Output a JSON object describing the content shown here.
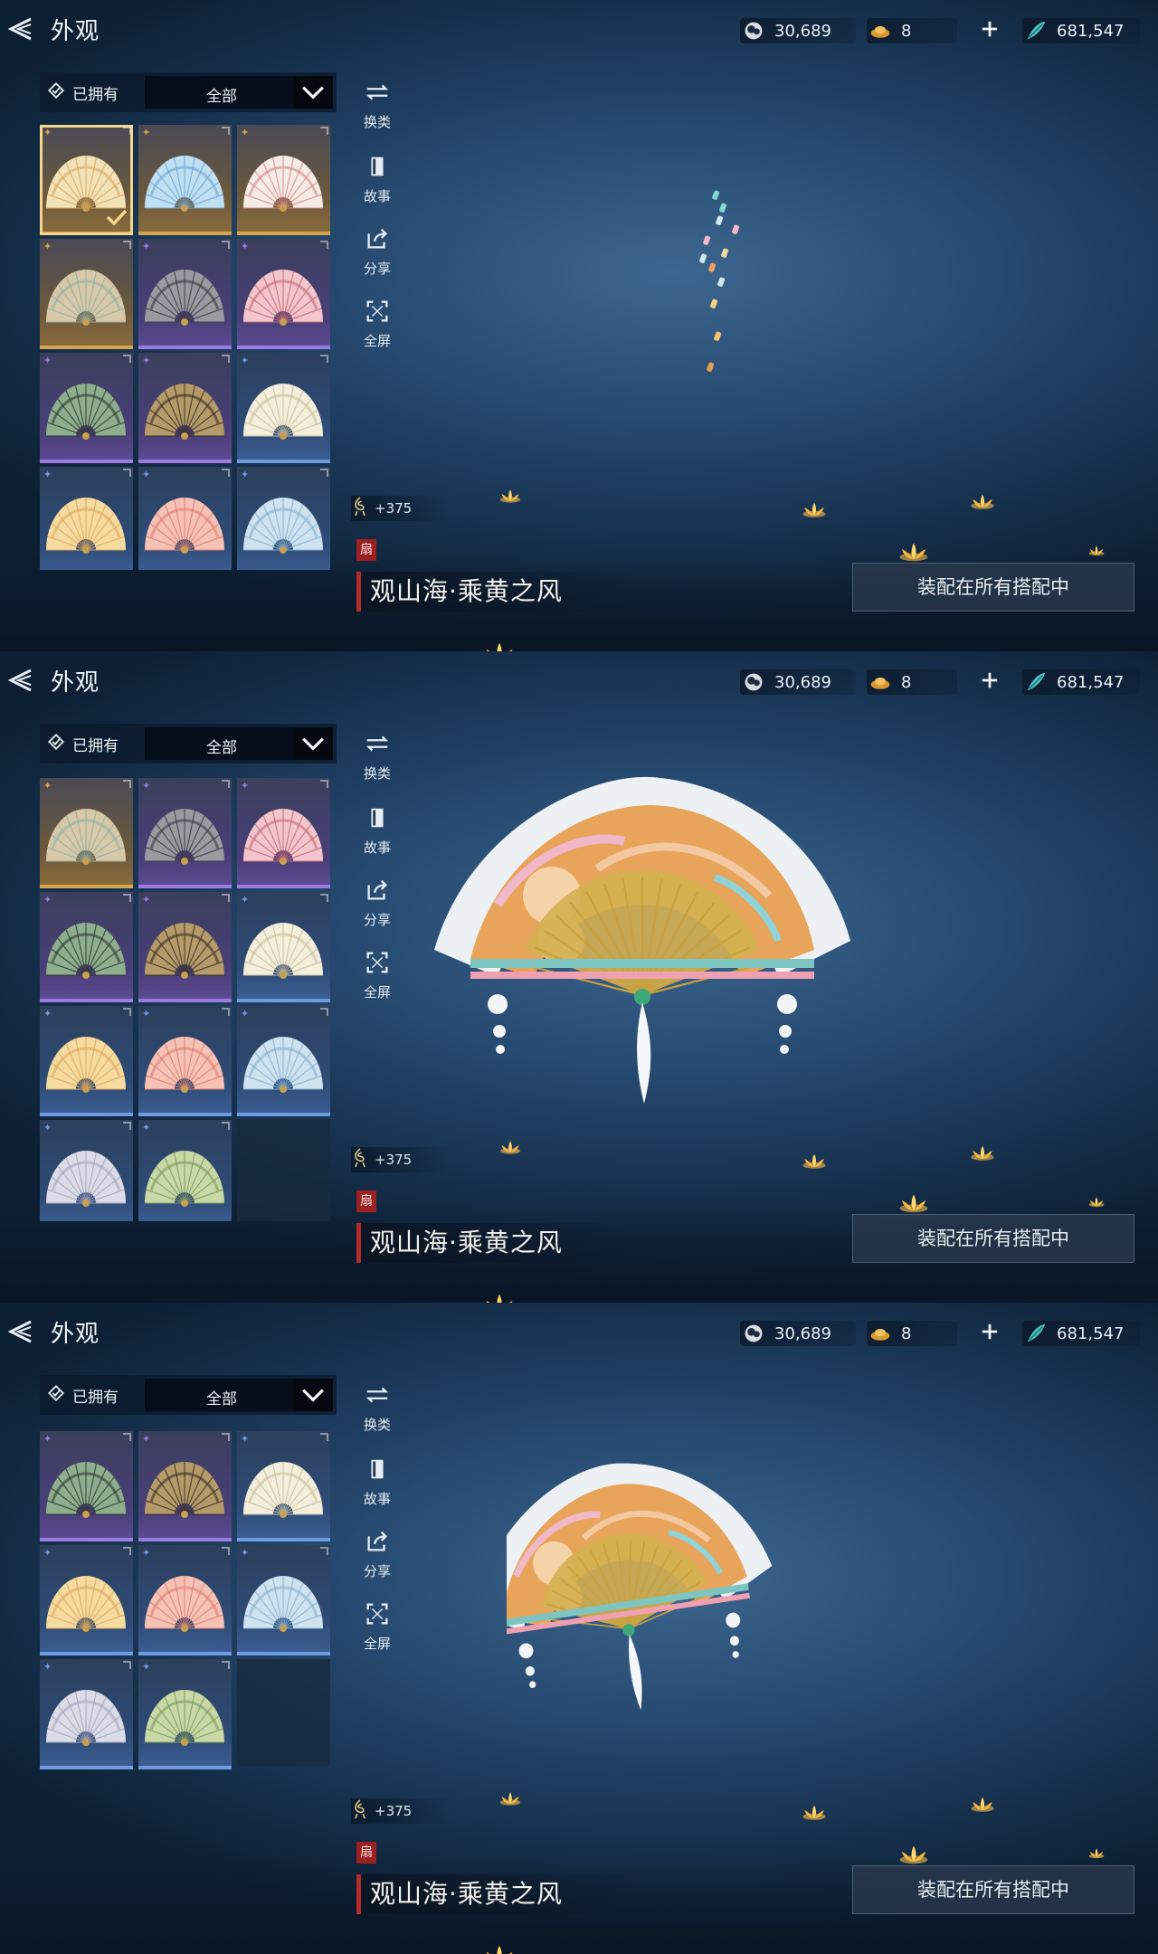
{
  "colors": {
    "accent_gold": "#d6a44c",
    "accent_purple": "#9a7ce0",
    "accent_blue": "#6e9ae0",
    "tag_red": "#9c1f22"
  },
  "panels": [
    {
      "header": {
        "title": "外观"
      },
      "currencies": [
        {
          "icon": "silver-coin-icon",
          "value": "30,689"
        },
        {
          "icon": "gold-ingot-icon",
          "value": "8"
        },
        {
          "icon": "jade-feather-icon",
          "value": "681,547"
        }
      ],
      "filter": {
        "owned_label": "已拥有",
        "select_value": "全部"
      },
      "tools": [
        {
          "icon": "swap-icon",
          "label": "换类"
        },
        {
          "icon": "book-icon",
          "label": "故事"
        },
        {
          "icon": "share-icon",
          "label": "分享"
        },
        {
          "icon": "fullscreen-icon",
          "label": "全屏"
        }
      ],
      "score": "+375",
      "item_tag": "扇",
      "item_name": "观山海·乘黄之风",
      "equip_label": "装配在所有搭配中"
    },
    {
      "header": {
        "title": "外观"
      },
      "currencies": [
        {
          "icon": "silver-coin-icon",
          "value": "30,689"
        },
        {
          "icon": "gold-ingot-icon",
          "value": "8"
        },
        {
          "icon": "jade-feather-icon",
          "value": "681,547"
        }
      ],
      "filter": {
        "owned_label": "已拥有",
        "select_value": "全部"
      },
      "tools": [
        {
          "icon": "swap-icon",
          "label": "换类"
        },
        {
          "icon": "book-icon",
          "label": "故事"
        },
        {
          "icon": "share-icon",
          "label": "分享"
        },
        {
          "icon": "fullscreen-icon",
          "label": "全屏"
        }
      ],
      "score": "+375",
      "item_tag": "扇",
      "item_name": "观山海·乘黄之风",
      "equip_label": "装配在所有搭配中"
    },
    {
      "header": {
        "title": "外观"
      },
      "currencies": [
        {
          "icon": "silver-coin-icon",
          "value": "30,689"
        },
        {
          "icon": "gold-ingot-icon",
          "value": "8"
        },
        {
          "icon": "jade-feather-icon",
          "value": "681,547"
        }
      ],
      "filter": {
        "owned_label": "已拥有",
        "select_value": "全部"
      },
      "tools": [
        {
          "icon": "swap-icon",
          "label": "换类"
        },
        {
          "icon": "book-icon",
          "label": "故事"
        },
        {
          "icon": "share-icon",
          "label": "分享"
        },
        {
          "icon": "fullscreen-icon",
          "label": "全屏"
        }
      ],
      "score": "+375",
      "item_tag": "扇",
      "item_name": "观山海·乘黄之风",
      "equip_label": "装配在所有搭配中"
    }
  ],
  "fan_items": [
    {
      "rarity": "gold",
      "palette": [
        "#f2e2b8",
        "#d9a860"
      ],
      "selected": true
    },
    {
      "rarity": "gold",
      "palette": [
        "#bfe0f2",
        "#6fa7d6"
      ]
    },
    {
      "rarity": "gold",
      "palette": [
        "#f6ece6",
        "#d98a8a"
      ]
    },
    {
      "rarity": "gold",
      "palette": [
        "#d8c8a8",
        "#8fb0a8"
      ]
    },
    {
      "rarity": "purple",
      "palette": [
        "#9a9aa0",
        "#3c3c44"
      ]
    },
    {
      "rarity": "purple",
      "palette": [
        "#f2c6cc",
        "#c46a78"
      ]
    },
    {
      "rarity": "purple",
      "palette": [
        "#8fae8e",
        "#2e3a30"
      ]
    },
    {
      "rarity": "purple",
      "palette": [
        "#b59a6a",
        "#3a3226"
      ]
    },
    {
      "rarity": "blue",
      "palette": [
        "#f4eedc",
        "#c9c0a0"
      ]
    },
    {
      "rarity": "blue",
      "palette": [
        "#f5dba0",
        "#e0a860"
      ]
    },
    {
      "rarity": "blue",
      "palette": [
        "#f6c2b6",
        "#de7e72"
      ]
    },
    {
      "rarity": "blue",
      "palette": [
        "#cfe2ee",
        "#86b2d2"
      ]
    },
    {
      "rarity": "blue",
      "palette": [
        "#dcdce8",
        "#a6a6bc"
      ]
    },
    {
      "rarity": "blue",
      "palette": [
        "#c8d8a6",
        "#7e9a62"
      ]
    },
    {
      "rarity": "empty"
    }
  ],
  "rarity_symbols": {
    "gold": "✦",
    "purple": "✦",
    "blue": "✦"
  }
}
